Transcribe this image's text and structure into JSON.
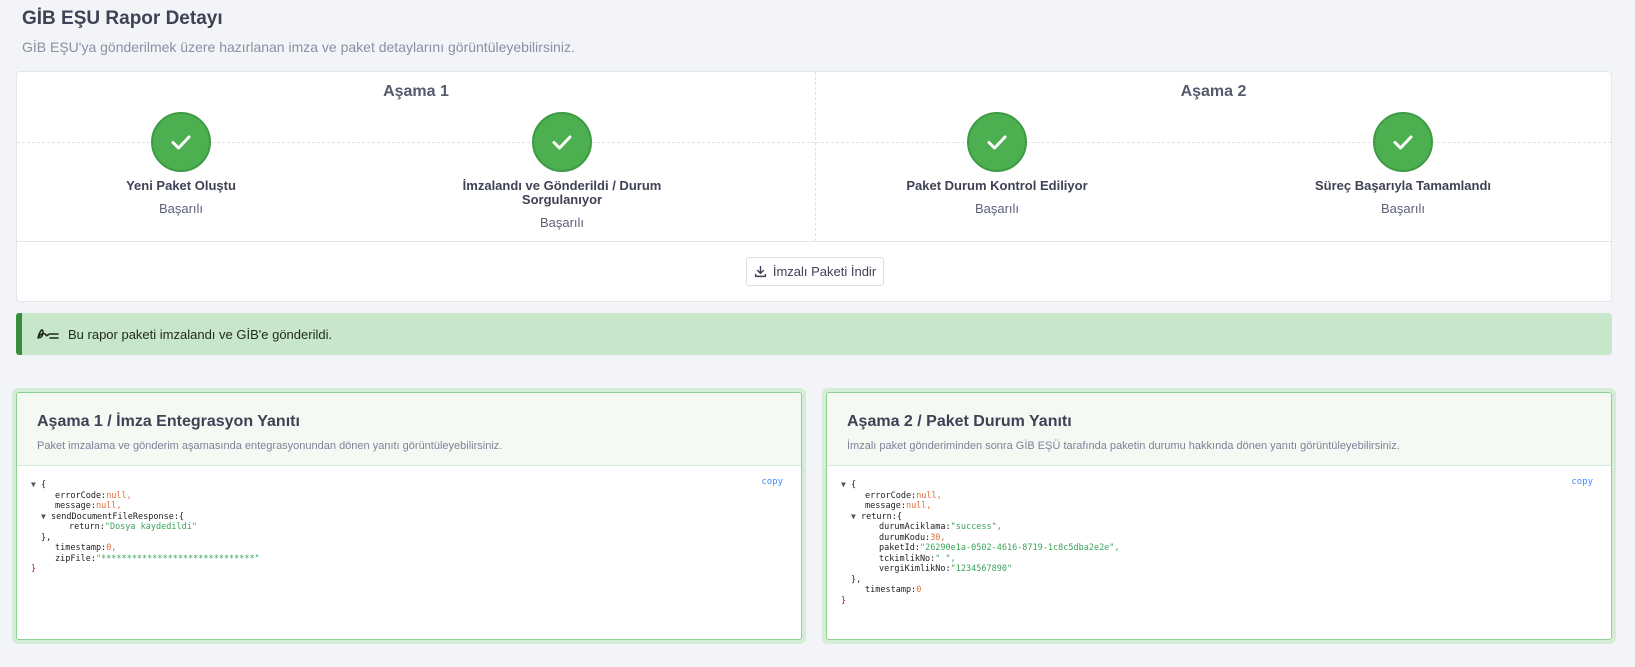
{
  "page": {
    "title": "GİB EŞU Rapor Detayı",
    "subtitle": "GİB EŞU'ya gönderilmek üzere hazırlanan imza ve paket detaylarını görüntüleyebilirsiniz."
  },
  "stages": [
    {
      "title": "Aşama 1",
      "steps": [
        {
          "label": "Yeni Paket Oluştu",
          "status": "Başarılı"
        },
        {
          "label": "İmzalandı ve Gönderildi / Durum Sorgulanıyor",
          "status": "Başarılı"
        }
      ]
    },
    {
      "title": "Aşama 2",
      "steps": [
        {
          "label": "Paket Durum Kontrol Ediliyor",
          "status": "Başarılı"
        },
        {
          "label": "Süreç Başarıyla Tamamlandı",
          "status": "Başarılı"
        }
      ]
    }
  ],
  "download_button": {
    "label": "İmzalı Paketi İndir",
    "icon": "download-icon"
  },
  "alert": {
    "text": "Bu rapor paketi imzalandı ve GİB'e gönderildi.",
    "icon": "signature-icon"
  },
  "panels": [
    {
      "title": "Aşama 1 / İmza Entegrasyon Yanıtı",
      "description": "Paket imzalama ve gönderim aşamasında entegrasyonundan dönen yanıtı görüntüleyebilirsiniz.",
      "copy_label": "copy",
      "json": {
        "open": "{",
        "error_key": "errorCode:",
        "error_val": "null,",
        "message_key": "message:",
        "message_val": "null,",
        "send_key": "sendDocumentFileResponse:{",
        "return_key": "return:",
        "return_val": "\"Dosya kaydedildi\"",
        "send_close": "},",
        "ts_key": "timestamp:",
        "ts_val": "0,",
        "zip_key": "zipFile:",
        "zip_val": "\"******************************\"",
        "close": "}"
      }
    },
    {
      "title": "Aşama 2 / Paket Durum Yanıtı",
      "description": "İmzalı paket gönderiminden sonra GİB EŞÜ tarafında paketin durumu hakkında dönen yanıtı görüntüleyebilirsiniz.",
      "copy_label": "copy",
      "json": {
        "open": "{",
        "error_key": "errorCode:",
        "error_val": "null,",
        "message_key": "message:",
        "message_val": "null,",
        "return_key": "return:{",
        "da_key": "durumAciklama:",
        "da_val": "\"success\",",
        "dk_key": "durumKodu:",
        "dk_val": "30,",
        "pid_key": "paketId:",
        "pid_val": "\"26290e1a-0502-4616-8719-1c8c5dba2e2e\",",
        "tck_key": "tckimlikNo:",
        "tck_val": "\" \",",
        "vkn_key": "vergiKimlikNo:",
        "vkn_val": "\"1234567890\"",
        "return_close": "},",
        "ts_key": "timestamp:",
        "ts_val": "0",
        "close": "}"
      }
    }
  ],
  "colors": {
    "success": "#4caf50",
    "alert_bg": "#c8e6c9",
    "alert_border": "#388e3c",
    "link": "#3d8bfd"
  }
}
